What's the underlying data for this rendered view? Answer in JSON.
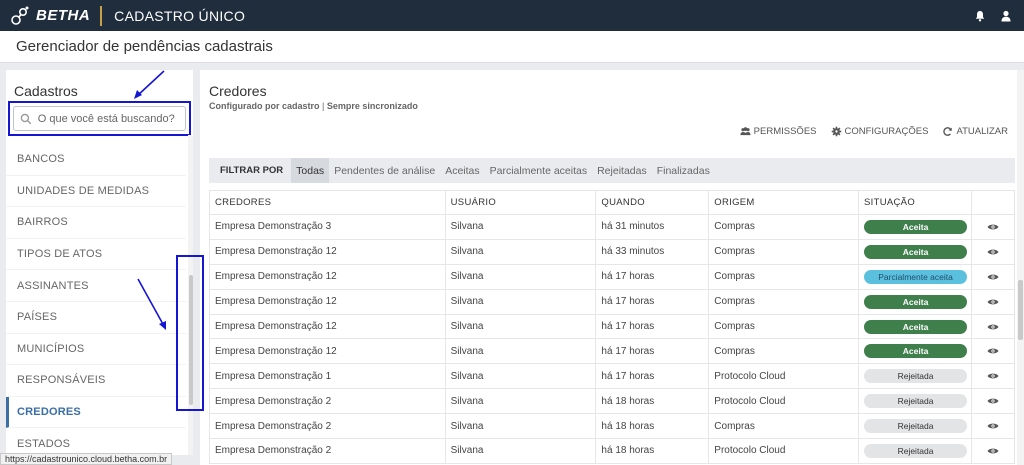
{
  "topbar": {
    "brand": "BETHA",
    "app_title": "CADASTRO ÚNICO",
    "icons": [
      "bell-icon",
      "user-icon"
    ]
  },
  "page": {
    "title": "Gerenciador de pendências cadastrais"
  },
  "sidebar": {
    "title": "Cadastros",
    "search_placeholder": "O que você está buscando?",
    "items": [
      {
        "label": "BANCOS"
      },
      {
        "label": "UNIDADES DE MEDIDAS"
      },
      {
        "label": "BAIRROS"
      },
      {
        "label": "TIPOS DE ATOS"
      },
      {
        "label": "ASSINANTES"
      },
      {
        "label": "PAÍSES"
      },
      {
        "label": "MUNICÍPIOS"
      },
      {
        "label": "RESPONSÁVEIS"
      },
      {
        "label": "CREDORES",
        "active": true
      },
      {
        "label": "ESTADOS"
      }
    ]
  },
  "main": {
    "title": "Credores",
    "subtitle_bold": "Configurado por cadastro",
    "subtitle_sep": "|",
    "subtitle_rest": "Sempre sincronizado",
    "actions": {
      "permissions": "PERMISSÕES",
      "settings": "CONFIGURAÇÕES",
      "refresh": "ATUALIZAR"
    },
    "filter": {
      "label": "FILTRAR POR",
      "tabs": [
        "Todas",
        "Pendentes de análise",
        "Aceitas",
        "Parcialmente aceitas",
        "Rejeitadas",
        "Finalizadas"
      ],
      "active": "Todas"
    },
    "columns": [
      "CREDORES",
      "USUÁRIO",
      "QUANDO",
      "ORIGEM",
      "SITUAÇÃO"
    ],
    "rows": [
      {
        "credor": "Empresa Demonstração 3",
        "usuario": "Silvana",
        "quando": "há 31 minutos",
        "origem": "Compras",
        "situacao": "Aceita",
        "status": "ok"
      },
      {
        "credor": "Empresa Demonstração 12",
        "usuario": "Silvana",
        "quando": "há 33 minutos",
        "origem": "Compras",
        "situacao": "Aceita",
        "status": "ok"
      },
      {
        "credor": "Empresa Demonstração 12",
        "usuario": "Silvana",
        "quando": "há 17 horas",
        "origem": "Compras",
        "situacao": "Parcialmente aceita",
        "status": "part"
      },
      {
        "credor": "Empresa Demonstração 12",
        "usuario": "Silvana",
        "quando": "há 17 horas",
        "origem": "Compras",
        "situacao": "Aceita",
        "status": "ok"
      },
      {
        "credor": "Empresa Demonstração 12",
        "usuario": "Silvana",
        "quando": "há 17 horas",
        "origem": "Compras",
        "situacao": "Aceita",
        "status": "ok"
      },
      {
        "credor": "Empresa Demonstração 12",
        "usuario": "Silvana",
        "quando": "há 17 horas",
        "origem": "Compras",
        "situacao": "Aceita",
        "status": "ok"
      },
      {
        "credor": "Empresa Demonstração 1",
        "usuario": "Silvana",
        "quando": "há 17 horas",
        "origem": "Protocolo Cloud",
        "situacao": "Rejeitada",
        "status": "rej"
      },
      {
        "credor": "Empresa Demonstração 2",
        "usuario": "Silvana",
        "quando": "há 18 horas",
        "origem": "Protocolo Cloud",
        "situacao": "Rejeitada",
        "status": "rej"
      },
      {
        "credor": "Empresa Demonstração 2",
        "usuario": "Silvana",
        "quando": "há 18 horas",
        "origem": "Compras",
        "situacao": "Rejeitada",
        "status": "rej"
      },
      {
        "credor": "Empresa Demonstração 2",
        "usuario": "Silvana",
        "quando": "há 18 horas",
        "origem": "Protocolo Cloud",
        "situacao": "Rejeitada",
        "status": "rej"
      }
    ]
  },
  "colors": {
    "topbar": "#1f2d3d",
    "accent": "#3a6ea5",
    "ok": "#3f7f4c",
    "partial": "#5bc0de",
    "rejected": "#e3e4e6",
    "annotation": "#1515d6"
  },
  "statusbar": {
    "url": "https://cadastrounico.cloud.betha.com.br"
  }
}
